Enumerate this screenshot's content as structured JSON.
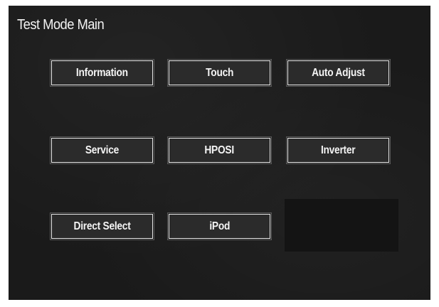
{
  "header": {
    "title": "Test Mode Main"
  },
  "buttons": {
    "information": "Information",
    "touch": "Touch",
    "auto_adjust": "Auto Adjust",
    "service": "Service",
    "hposi": "HPOSI",
    "inverter": "Inverter",
    "direct_select": "Direct Select",
    "ipod": "iPod"
  },
  "colors": {
    "screen_background": "#1a1a1a",
    "button_border": "#e8e8e8",
    "text": "#f4f4f4"
  }
}
